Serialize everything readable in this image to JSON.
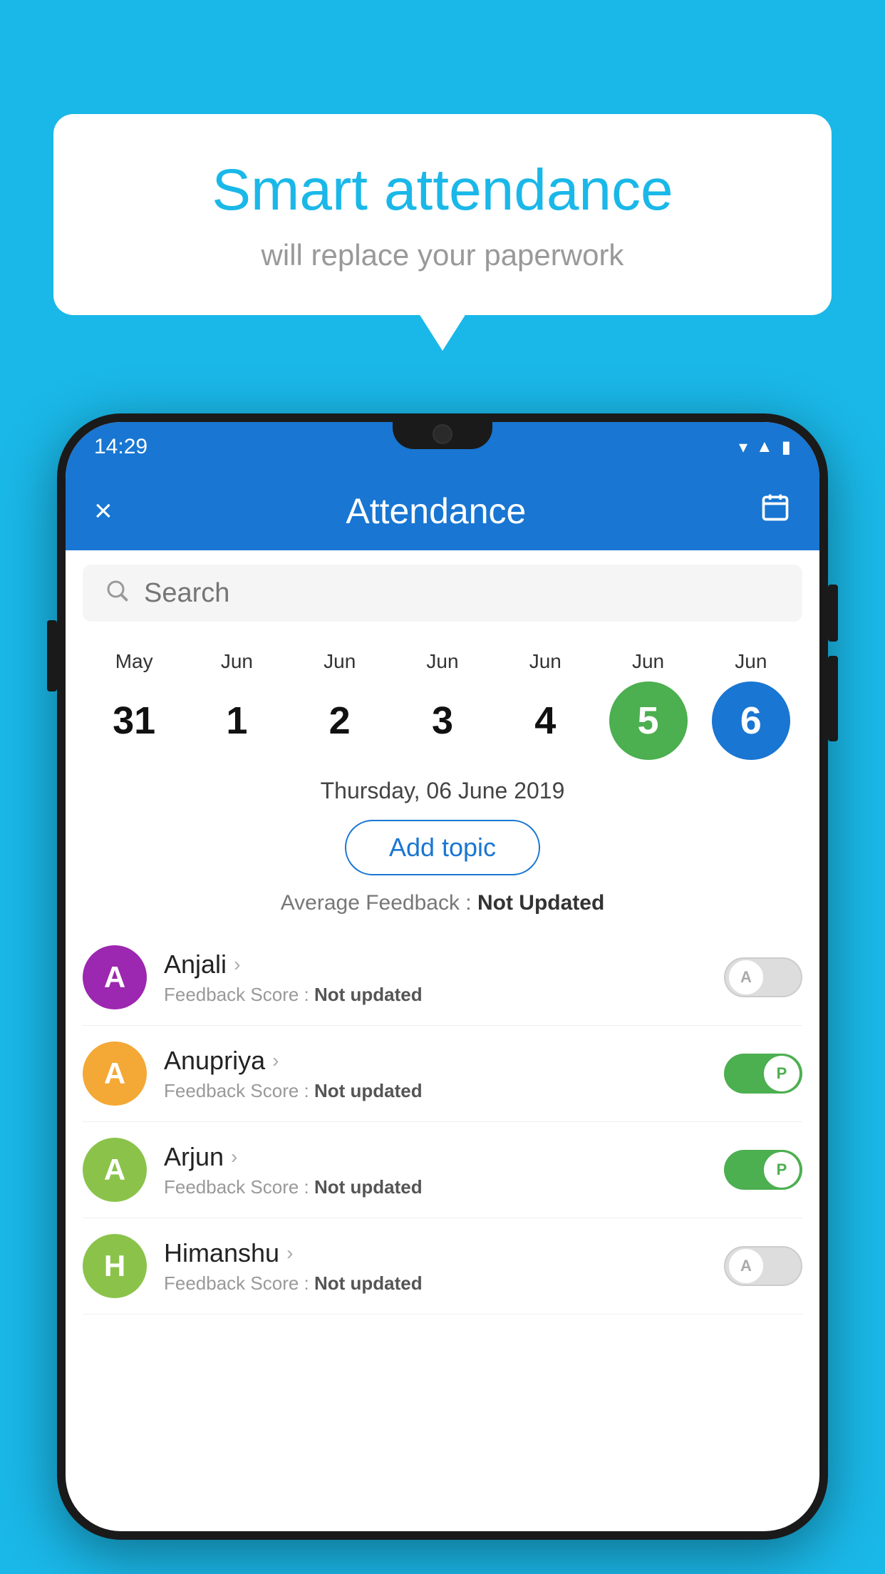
{
  "background_color": "#1ab8e8",
  "speech_bubble": {
    "title": "Smart attendance",
    "subtitle": "will replace your paperwork"
  },
  "status_bar": {
    "time": "14:29",
    "wifi_icon": "wifi",
    "signal_icon": "signal",
    "battery_icon": "battery"
  },
  "app_bar": {
    "title": "Attendance",
    "close_label": "×",
    "calendar_label": "📅"
  },
  "search": {
    "placeholder": "Search"
  },
  "calendar": {
    "days": [
      {
        "month": "May",
        "date": "31",
        "state": "normal"
      },
      {
        "month": "Jun",
        "date": "1",
        "state": "normal"
      },
      {
        "month": "Jun",
        "date": "2",
        "state": "normal"
      },
      {
        "month": "Jun",
        "date": "3",
        "state": "normal"
      },
      {
        "month": "Jun",
        "date": "4",
        "state": "normal"
      },
      {
        "month": "Jun",
        "date": "5",
        "state": "today"
      },
      {
        "month": "Jun",
        "date": "6",
        "state": "selected"
      }
    ],
    "selected_date_label": "Thursday, 06 June 2019"
  },
  "add_topic_button": "Add topic",
  "avg_feedback": {
    "label": "Average Feedback :",
    "value": "Not Updated"
  },
  "students": [
    {
      "name": "Anjali",
      "avatar_letter": "A",
      "avatar_color": "#9c27b0",
      "feedback_label": "Feedback Score :",
      "feedback_value": "Not updated",
      "attendance": "A",
      "attendance_on": false
    },
    {
      "name": "Anupriya",
      "avatar_letter": "A",
      "avatar_color": "#f4a835",
      "feedback_label": "Feedback Score :",
      "feedback_value": "Not updated",
      "attendance": "P",
      "attendance_on": true
    },
    {
      "name": "Arjun",
      "avatar_letter": "A",
      "avatar_color": "#8bc34a",
      "feedback_label": "Feedback Score :",
      "feedback_value": "Not updated",
      "attendance": "P",
      "attendance_on": true
    },
    {
      "name": "Himanshu",
      "avatar_letter": "H",
      "avatar_color": "#8bc34a",
      "feedback_label": "Feedback Score :",
      "feedback_value": "Not updated",
      "attendance": "A",
      "attendance_on": false
    }
  ]
}
